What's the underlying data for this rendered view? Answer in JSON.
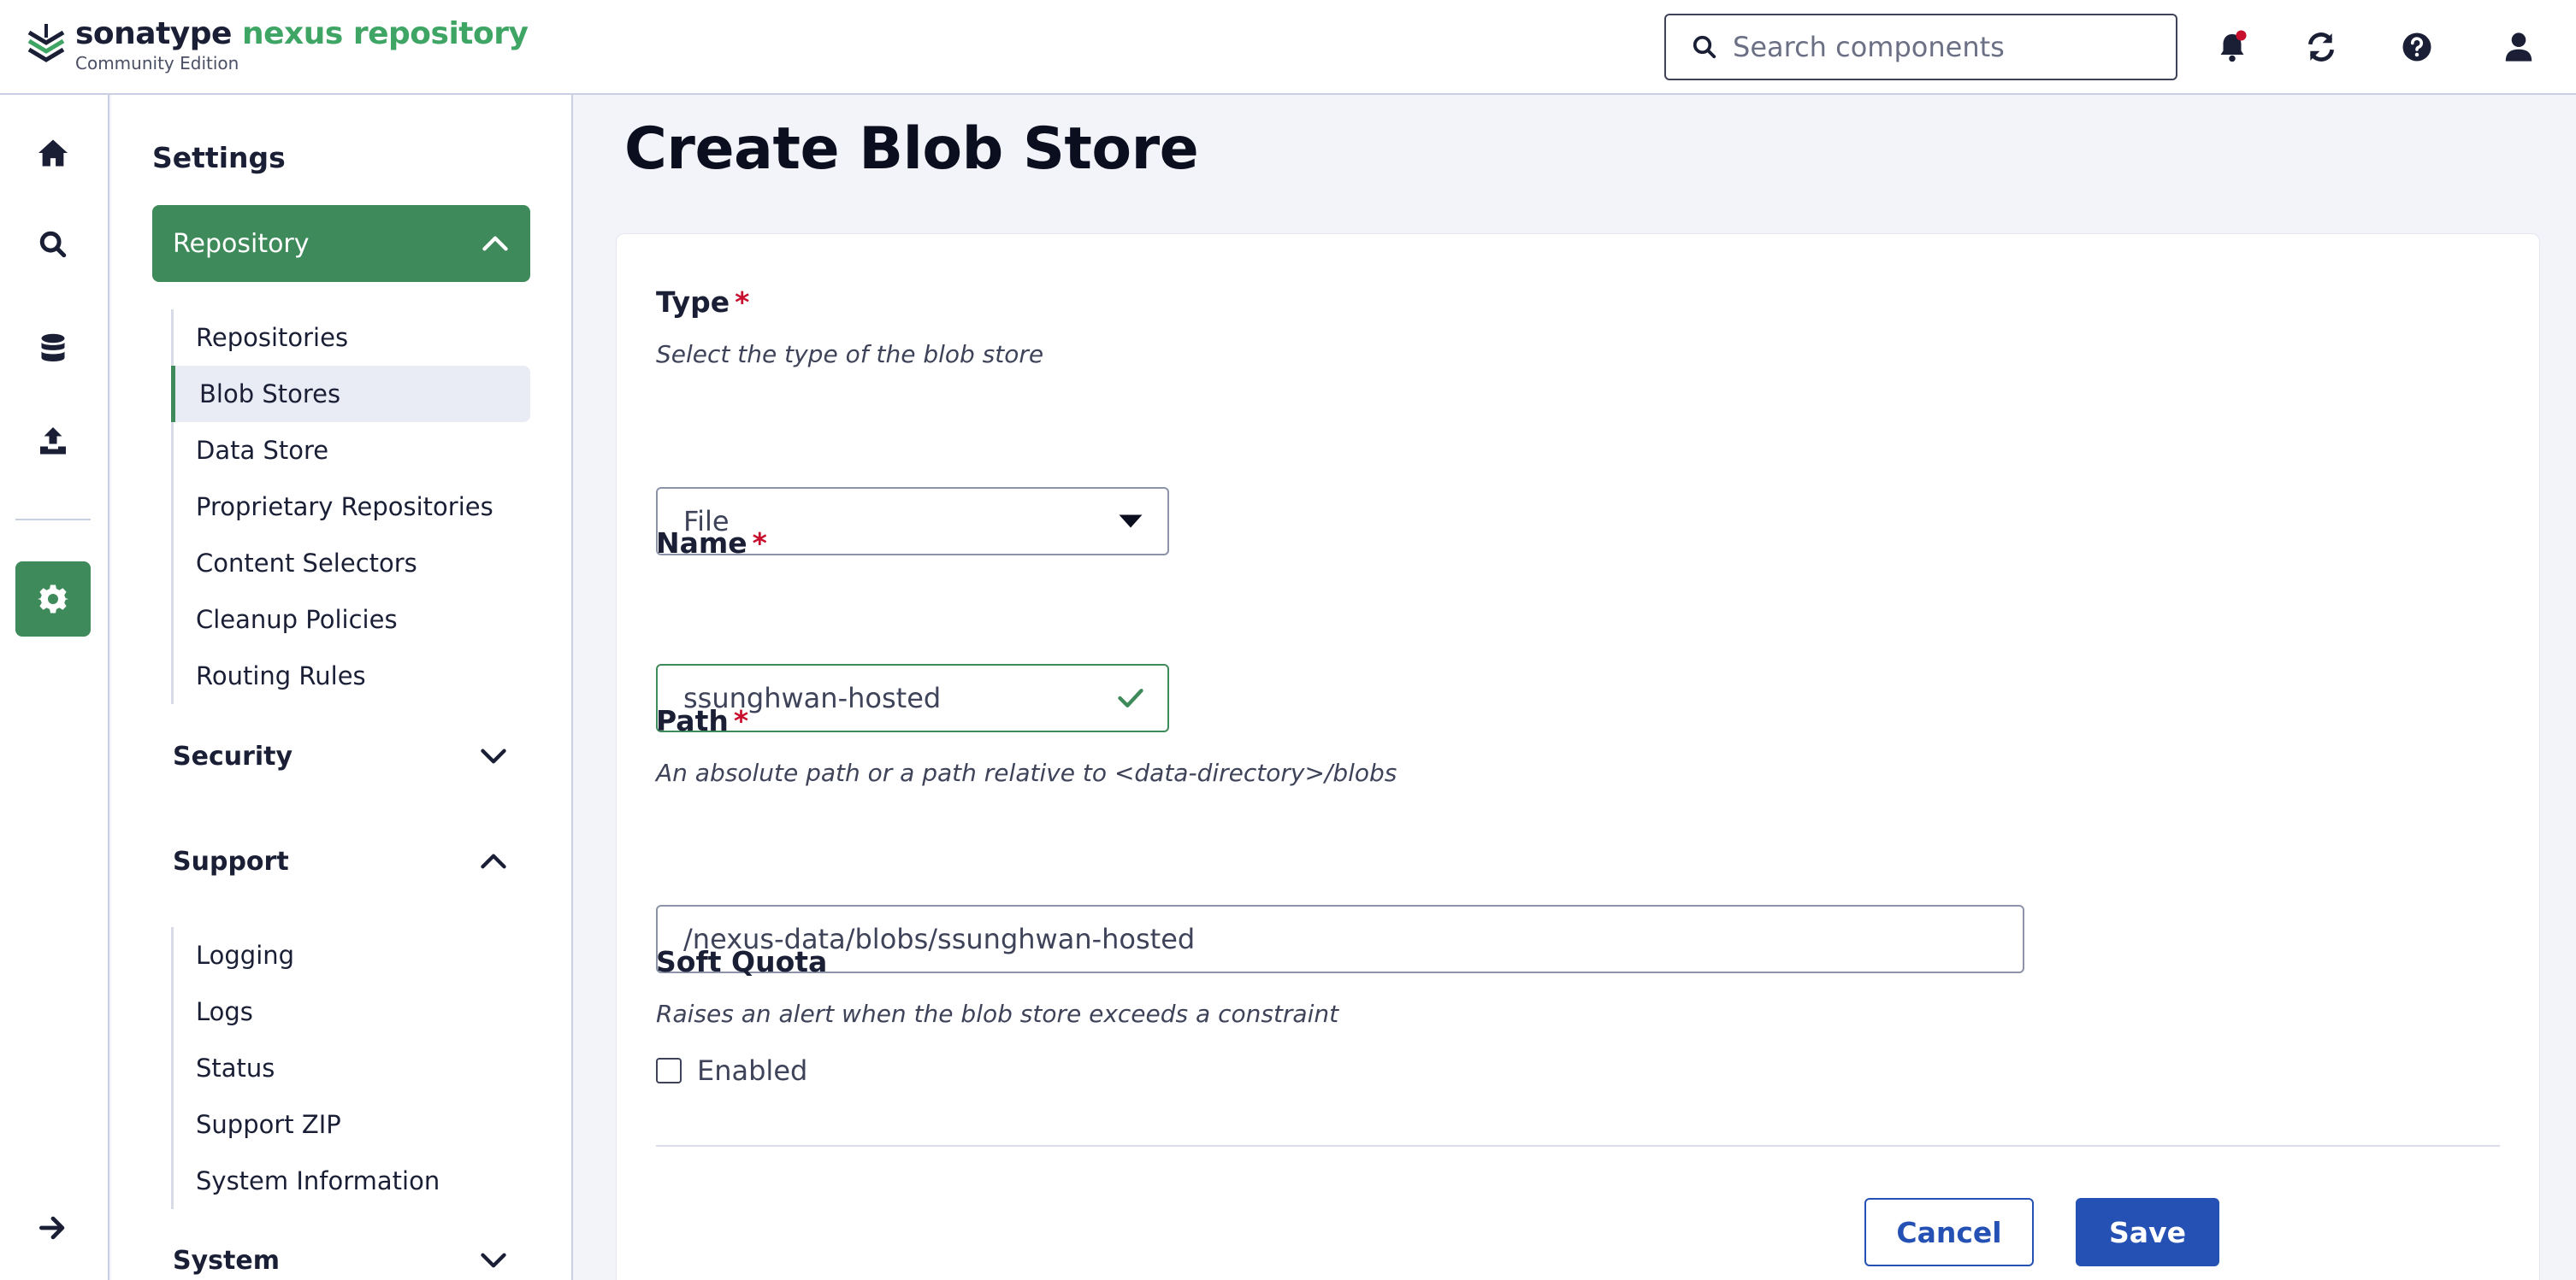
{
  "header": {
    "brand": "sonatype",
    "product": "nexus repository",
    "edition": "Community Edition",
    "search_placeholder": "Search components",
    "icons": [
      "bell-icon",
      "refresh-icon",
      "help-icon",
      "user-icon"
    ],
    "notification_dot_color": "#c8102e"
  },
  "rail": {
    "items": [
      "home-icon",
      "search-icon",
      "database-icon",
      "upload-icon",
      "gear-icon",
      "arrow-right-icon"
    ],
    "active": "gear-icon"
  },
  "sidebar": {
    "title": "Settings",
    "groups": {
      "repository": {
        "label": "Repository",
        "expanded": true,
        "items": [
          "Repositories",
          "Blob Stores",
          "Data Store",
          "Proprietary Repositories",
          "Content Selectors",
          "Cleanup Policies",
          "Routing Rules"
        ],
        "active_item": "Blob Stores"
      },
      "security": {
        "label": "Security",
        "expanded": false
      },
      "support": {
        "label": "Support",
        "expanded": true,
        "items": [
          "Logging",
          "Logs",
          "Status",
          "Support ZIP",
          "System Information"
        ]
      },
      "system": {
        "label": "System",
        "expanded": false
      }
    }
  },
  "main": {
    "title": "Create Blob Store",
    "form": {
      "type": {
        "label": "Type",
        "required_mark": "*",
        "description": "Select the type of the blob store",
        "value": "File"
      },
      "name": {
        "label": "Name",
        "required_mark": "*",
        "value": "ssunghwan-hosted"
      },
      "path": {
        "label": "Path",
        "required_mark": "*",
        "description": "An absolute path or a path relative to <data-directory>/blobs",
        "value": "/nexus-data/blobs/ssunghwan-hosted"
      },
      "soft_quota": {
        "label": "Soft Quota",
        "description": "Raises an alert when the blob store exceeds a constraint",
        "checkbox_label": "Enabled",
        "checked": false
      }
    },
    "buttons": {
      "cancel": "Cancel",
      "save": "Save"
    }
  },
  "colors": {
    "accent_green": "#3f8a5a",
    "brand_green": "#3fa564",
    "primary_blue": "#2451b3",
    "required_red": "#c8102e"
  }
}
